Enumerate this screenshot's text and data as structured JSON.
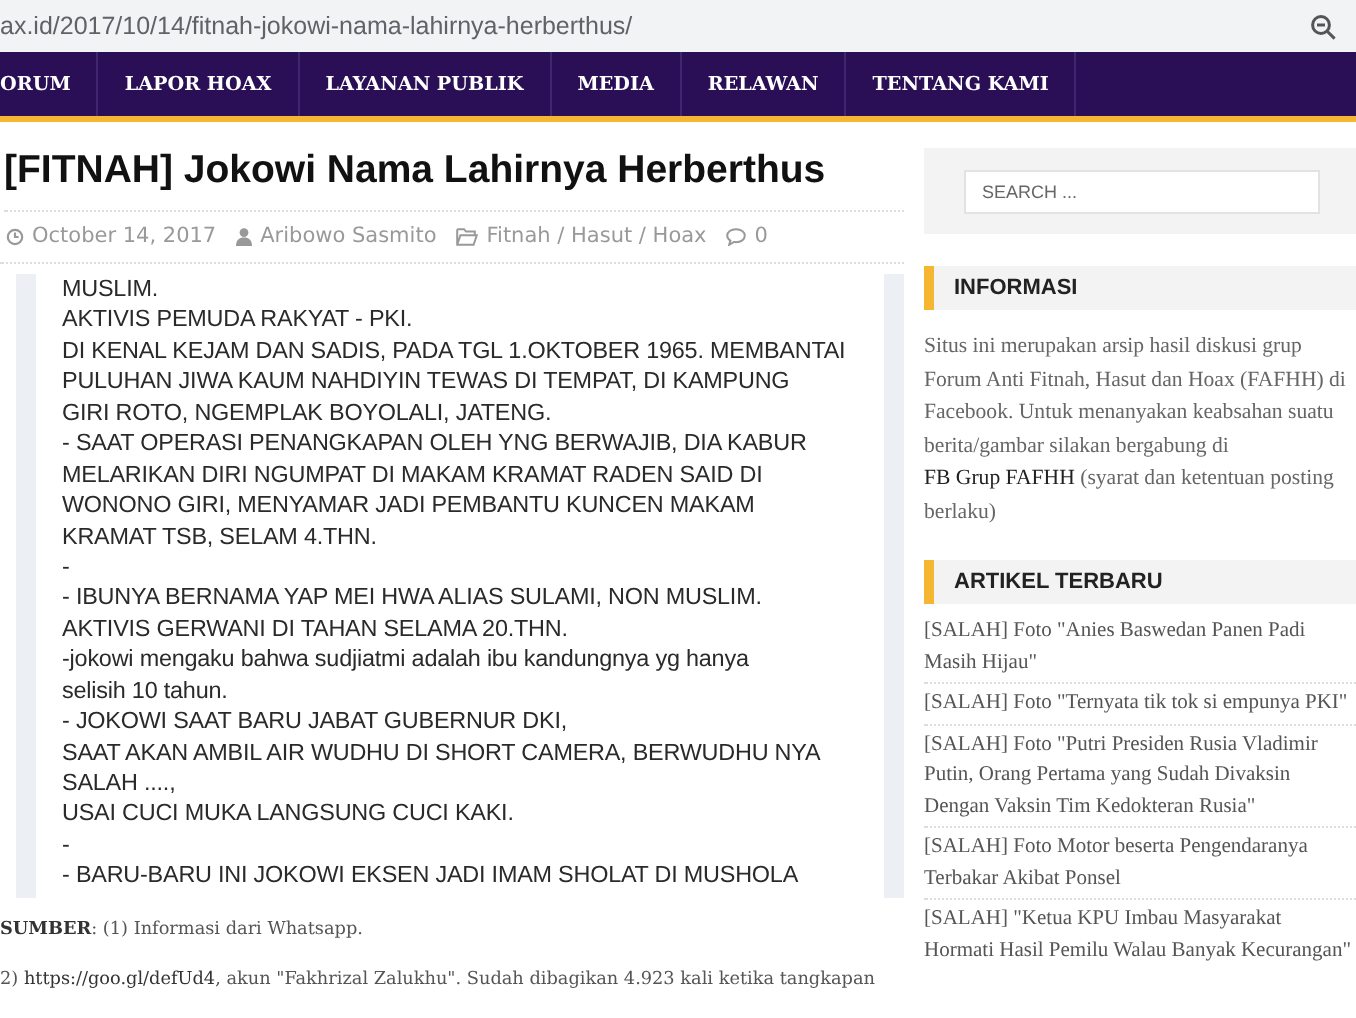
{
  "address_bar": {
    "url": "ax.id/2017/10/14/fitnah-jokowi-nama-lahirnya-herberthus/"
  },
  "nav": {
    "items": [
      "ORUM",
      "LAPOR HOAX",
      "LAYANAN PUBLIK",
      "MEDIA",
      "RELAWAN",
      "TENTANG KAMI"
    ]
  },
  "article": {
    "title": "[FITNAH] Jokowi Nama Lahirnya Herberthus",
    "meta": {
      "date": "October 14, 2017",
      "author": "Aribowo Sasmito",
      "category": "Fitnah / Hasut / Hoax",
      "comments": "0"
    },
    "post_screenshot": {
      "lines": [
        "MUSLIM.",
        "AKTIVIS PEMUDA RAKYAT - PKI.",
        "DI KENAL KEJAM DAN SADIS, PADA TGL 1.OKTOBER 1965. MEMBANTAI",
        "PULUHAN JIWA KAUM NAHDIYIN TEWAS DI TEMPAT, DI KAMPUNG",
        "GIRI ROTO, NGEMPLAK BOYOLALI, JATENG.",
        "- SAAT OPERASI PENANGKAPAN OLEH YNG BERWAJIB, DIA KABUR",
        "MELARIKAN DIRI NGUMPAT DI MAKAM KRAMAT RADEN SAID DI",
        "WONONO GIRI, MENYAMAR JADI PEMBANTU KUNCEN MAKAM",
        "KRAMAT TSB, SELAM 4.THN.",
        "-",
        "- IBUNYA BERNAMA YAP MEI HWA ALIAS SULAMI, NON MUSLIM.",
        "AKTIVIS GERWANI DI TAHAN SELAMA 20.THN.",
        "-jokowi mengaku bahwa sudjiatmi adalah ibu kandungnya yg hanya",
        "selisih 10 tahun.",
        "- JOKOWI SAAT BARU JABAT GUBERNUR DKI,",
        "SAAT AKAN AMBIL AIR WUDHU DI SHORT CAMERA, BERWUDHU NYA",
        "SALAH ....,",
        "USAI CUCI MUKA LANGSUNG CUCI KAKI.",
        "-",
        "- BARU-BARU INI JOKOWI EKSEN JADI IMAM SHOLAT DI MUSHOLA"
      ]
    },
    "sources": [
      {
        "text": "**SUMBER**: (1) Informasi dari Whatsapp."
      },
      {
        "prefix": "2) ",
        "link": "https://goo.gl/defUd4",
        "suffix": ", akun \"Fakhrizal Zalukhu\". Sudah dibagikan 4.923 kali ketika tangkapan"
      }
    ]
  },
  "sidebar": {
    "search": {
      "placeholder": "SEARCH ..."
    },
    "widgets": [
      {
        "kind": "text",
        "title": "INFORMASI",
        "before": "Situs ini merupakan arsip hasil diskusi grup Forum Anti Fitnah, Hasut dan Hoax (FAFHH) di Facebook. Untuk menanyakan keabsahan suatu berita/gambar silakan bergabung di ",
        "link": "FB Grup FAFHH",
        "after": " (syarat dan ketentuan posting berlaku)"
      },
      {
        "kind": "list",
        "title": "ARTIKEL TERBARU",
        "items": [
          "[SALAH] Foto \"Anies Baswedan Panen Padi Masih Hijau\"",
          "[SALAH] Foto \"Ternyata tik tok si empunya PKI\"",
          "[SALAH] Foto \"Putri Presiden Rusia Vladimir Putin, Orang Pertama yang Sudah Divaksin Dengan Vaksin Tim Kedokteran Rusia\"",
          "[SALAH] Foto Motor beserta Pengendaranya Terbakar Akibat Ponsel",
          "[SALAH] \"Ketua KPU Imbau Masyarakat Hormati Hasil Pemilu Walau Banyak Kecurangan\""
        ]
      }
    ]
  }
}
